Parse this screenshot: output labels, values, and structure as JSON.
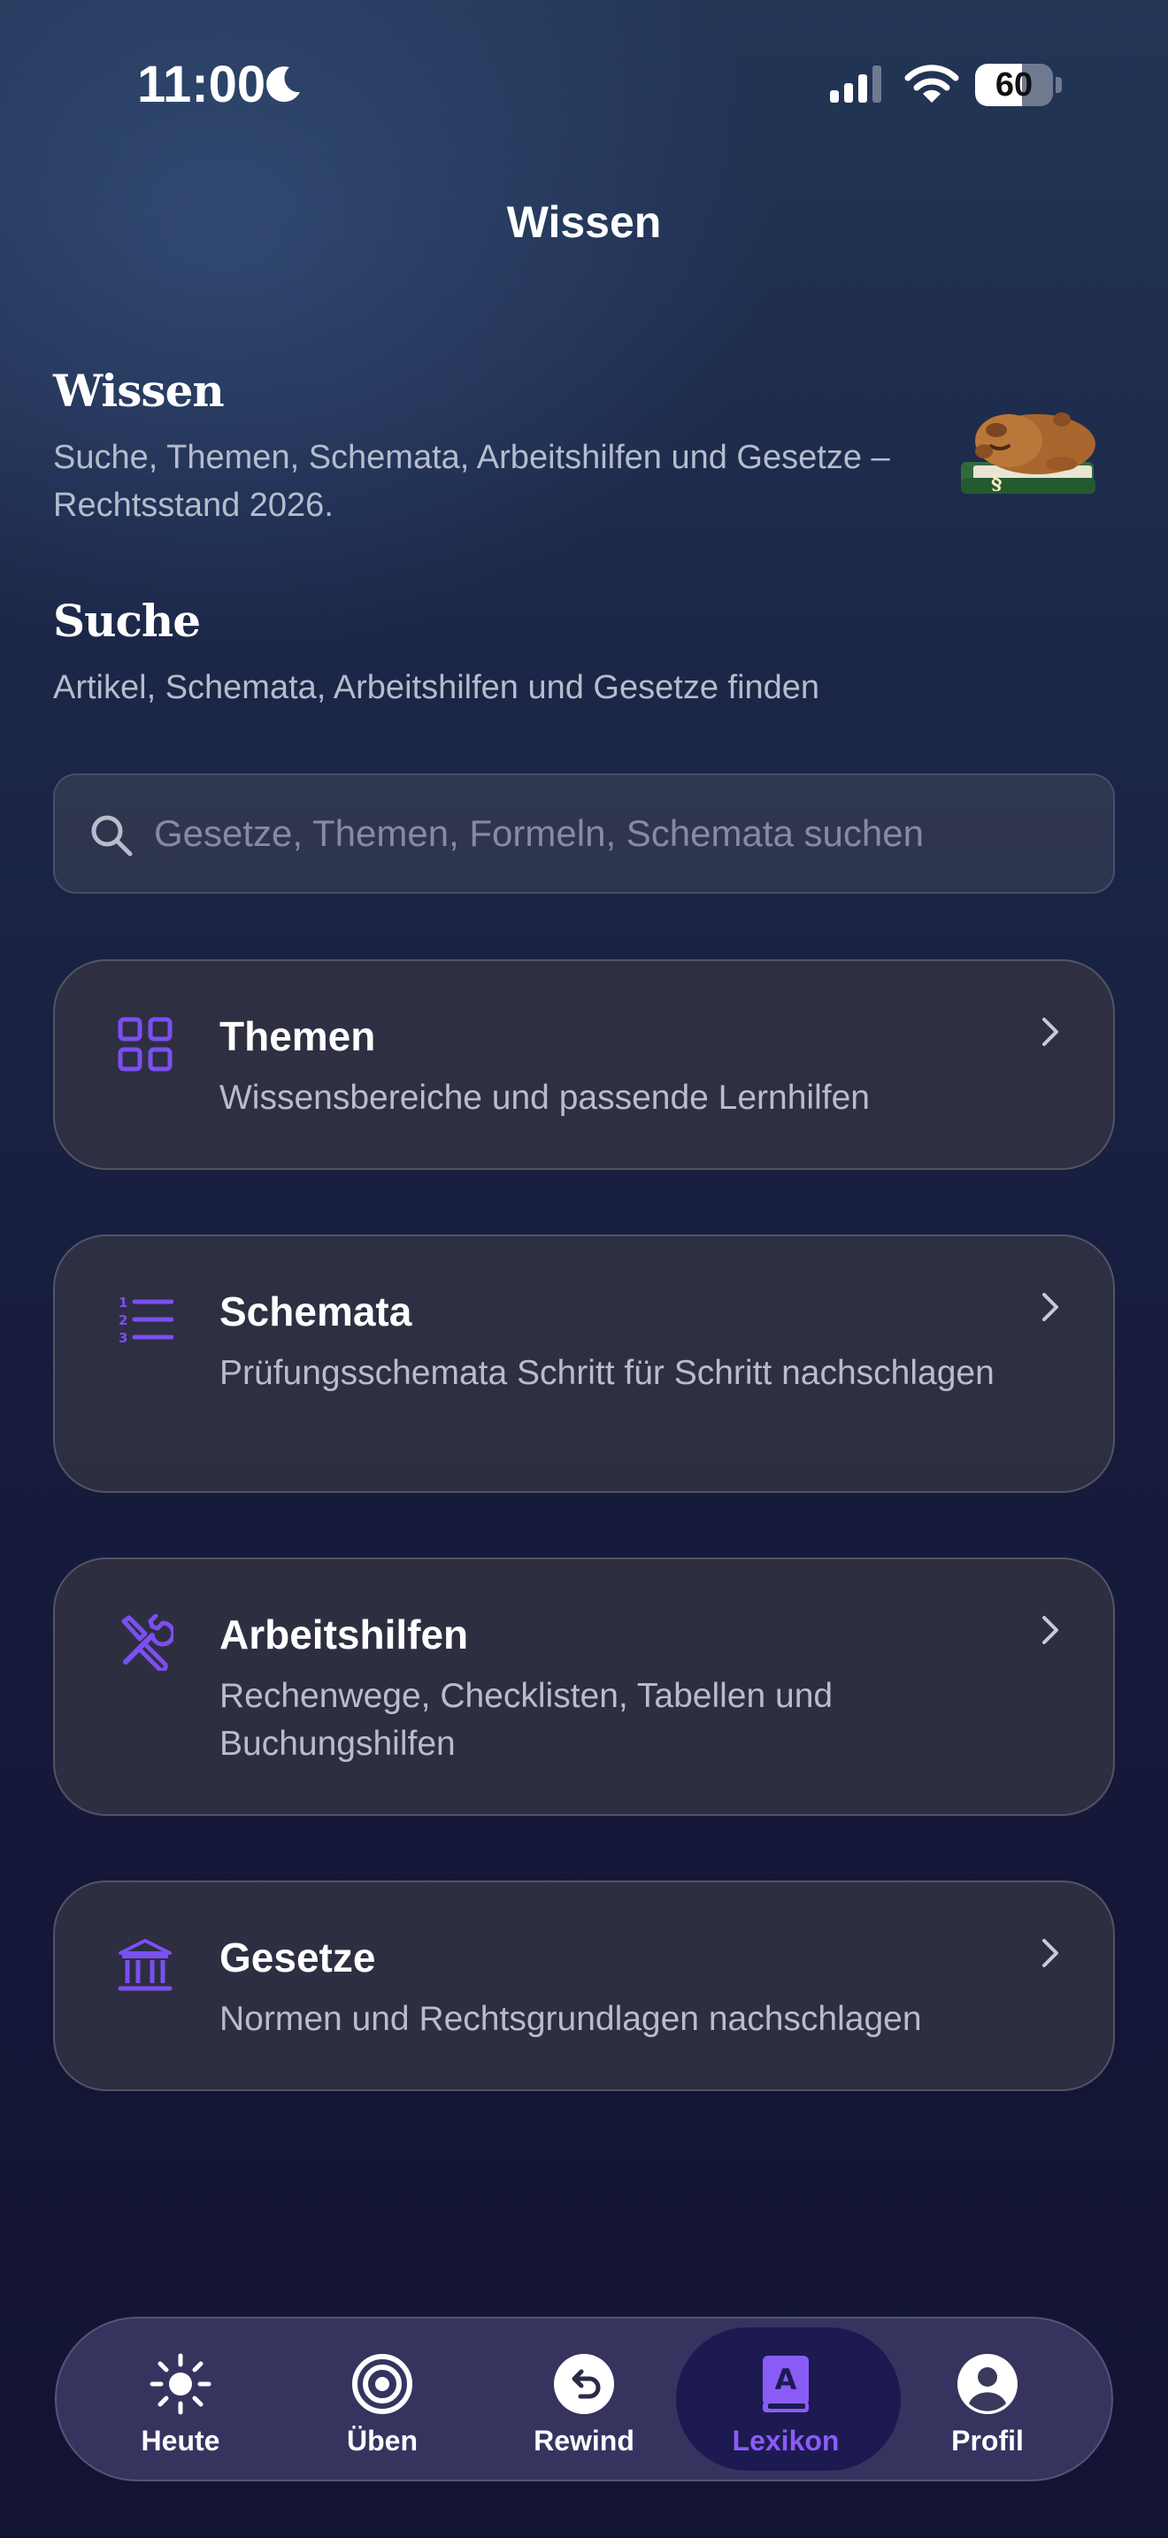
{
  "status_bar": {
    "time": "11:00",
    "battery": "60",
    "battery_level": 0.6,
    "icons": [
      "moon-icon",
      "cellular-signal-icon",
      "wifi-icon",
      "battery-icon"
    ]
  },
  "nav": {
    "title": "Wissen"
  },
  "header": {
    "title": "Wissen",
    "subtitle": "Suche, Themen, Schemata, Arbeitshilfen und Gesetze – Rechtsstand 2026.",
    "mascot_badge": "§"
  },
  "search_section": {
    "title": "Suche",
    "subtitle": "Artikel, Schemata, Arbeitshilfen und Gesetze finden",
    "placeholder": "Gesetze, Themen, Formeln, Schemata suchen",
    "value": ""
  },
  "cards": [
    {
      "title": "Themen",
      "description": "Wissensbereiche und passende Lernhilfen",
      "icon": "grid-icon"
    },
    {
      "title": "Schemata",
      "description": "Prüfungsschemata Schritt für Schritt nachschlagen",
      "icon": "numbered-list-icon"
    },
    {
      "title": "Arbeitshilfen",
      "description": "Rechenwege, Checklisten, Tabellen und Buchungshilfen",
      "icon": "tools-icon"
    },
    {
      "title": "Gesetze",
      "description": "Normen und Rechtsgrundlagen nachschlagen",
      "icon": "institution-icon"
    }
  ],
  "tabbar": {
    "tabs": [
      {
        "label": "Heute",
        "icon": "sun-icon",
        "active": false
      },
      {
        "label": "Üben",
        "icon": "target-icon",
        "active": false
      },
      {
        "label": "Rewind",
        "icon": "rewind-icon",
        "active": false
      },
      {
        "label": "Lexikon",
        "icon": "book-icon",
        "active": true
      },
      {
        "label": "Profil",
        "icon": "profile-icon",
        "active": false
      }
    ]
  },
  "colors": {
    "accent": "#7b4ff0",
    "active_tab_label": "#8a5cf6",
    "background_top": "#233656",
    "background_bottom": "#131432"
  }
}
